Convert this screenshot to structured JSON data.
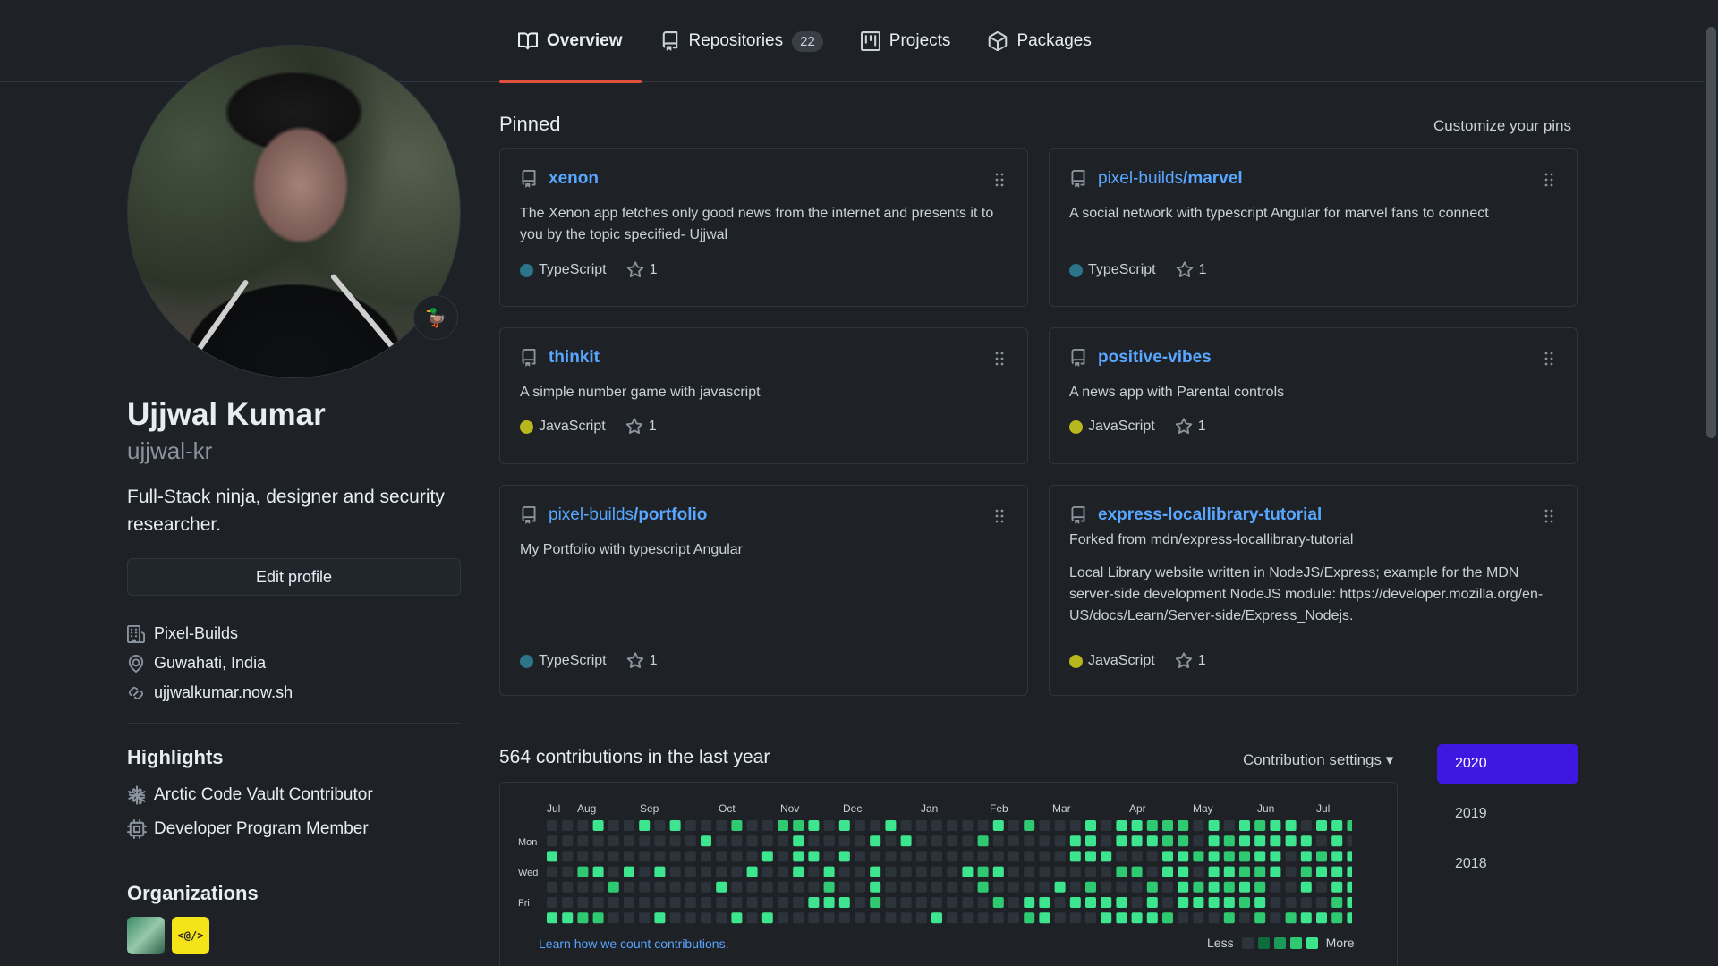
{
  "nav": {
    "tabs": [
      {
        "label": "Overview",
        "icon": "book-icon"
      },
      {
        "label": "Repositories",
        "icon": "repo-icon",
        "count": "22"
      },
      {
        "label": "Projects",
        "icon": "project-icon"
      },
      {
        "label": "Packages",
        "icon": "package-icon"
      }
    ],
    "active_color": "#e0503c"
  },
  "profile": {
    "name": "Ujjwal Kumar",
    "username": "ujjwal-kr",
    "bio": "Full-Stack ninja, designer and security researcher.",
    "edit_label": "Edit profile",
    "status_emoji": "🦆",
    "company": "Pixel-Builds",
    "location": "Guwahati, India",
    "website": "ujjwalkumar.now.sh"
  },
  "highlights": {
    "title": "Highlights",
    "items": [
      "Arctic Code Vault Contributor",
      "Developer Program Member"
    ]
  },
  "organizations": {
    "title": "Organizations",
    "items": [
      {
        "label": ""
      },
      {
        "label": "<@/>"
      }
    ]
  },
  "pinned": {
    "title": "Pinned",
    "customize": "Customize your pins",
    "repos": [
      {
        "owner": "",
        "name": "xenon",
        "desc": "The Xenon app fetches only good news from the internet and presents it to you by the topic specified- Ujjwal",
        "language": "TypeScript",
        "lang_color": "#2b7489",
        "stars": "1"
      },
      {
        "owner": "pixel-builds",
        "name": "/marvel",
        "desc": "A social network with typescript Angular for marvel fans to connect",
        "language": "TypeScript",
        "lang_color": "#2b7489",
        "stars": "1"
      },
      {
        "owner": "",
        "name": "thinkit",
        "desc": "A simple number game with javascript",
        "language": "JavaScript",
        "lang_color": "#b8b71c",
        "stars": "1"
      },
      {
        "owner": "",
        "name": "positive-vibes",
        "desc": "A news app with Parental controls",
        "language": "JavaScript",
        "lang_color": "#b8b71c",
        "stars": "1"
      },
      {
        "owner": "pixel-builds",
        "name": "/portfolio",
        "desc": "My Portfolio with typescript Angular",
        "language": "TypeScript",
        "lang_color": "#2b7489",
        "stars": "1"
      },
      {
        "owner": "",
        "name": "express-locallibrary-tutorial",
        "forked": "Forked from mdn/express-locallibrary-tutorial",
        "desc": "Local Library website written in NodeJS/Express; example for the MDN server-side development NodeJS module: https://developer.mozilla.org/en-US/docs/Learn/Server-side/Express_Nodejs.",
        "language": "JavaScript",
        "lang_color": "#b8b71c",
        "stars": "1"
      }
    ]
  },
  "contributions": {
    "title": "564 contributions in the last year",
    "settings_label": "Contribution settings ▾",
    "months": [
      "Jul",
      "Aug",
      "Sep",
      "Oct",
      "Nov",
      "Dec",
      "Jan",
      "Feb",
      "Mar",
      "Apr",
      "May",
      "Jun",
      "Jul"
    ],
    "days": [
      "Mon",
      "Wed",
      "Fri"
    ],
    "learn_label": "Learn how we count contributions.",
    "legend_less": "Less",
    "legend_more": "More",
    "levels": [
      "#2d333b",
      "#0e6b3c",
      "#1b9a57",
      "#2ec971",
      "#3ee58f"
    ],
    "years": [
      "2020",
      "2019",
      "2018"
    ],
    "active_year": "2020"
  }
}
